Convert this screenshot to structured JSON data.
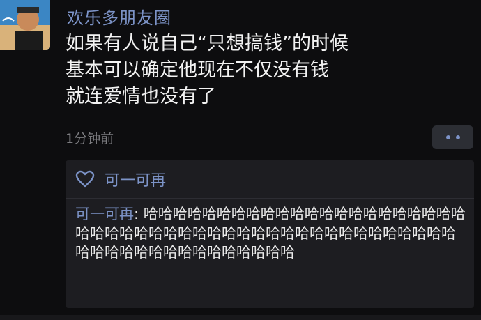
{
  "post": {
    "author": "欢乐多朋友圈",
    "content_lines": [
      "如果有人说自己“只想搞钱”的时候",
      "基本可以确定他现在不仅没有钱",
      "就连爱情也没有了"
    ],
    "time": "1分钟前"
  },
  "likes": {
    "icon": "heart-outline-icon",
    "liker": "可一可再"
  },
  "comment": {
    "author": "可一可再",
    "separator": ": ",
    "text": "哈哈哈哈哈哈哈哈哈哈哈哈哈哈哈哈哈哈哈哈哈哈哈哈哈哈哈哈哈哈哈哈哈哈哈哈哈哈哈哈哈哈哈哈哈哈哈哈哈哈哈哈哈哈哈哈哈哈哈哈哈哈哈"
  },
  "colors": {
    "link": "#7c93c7",
    "background": "#0d0d0f",
    "panel": "#1d1d21"
  }
}
